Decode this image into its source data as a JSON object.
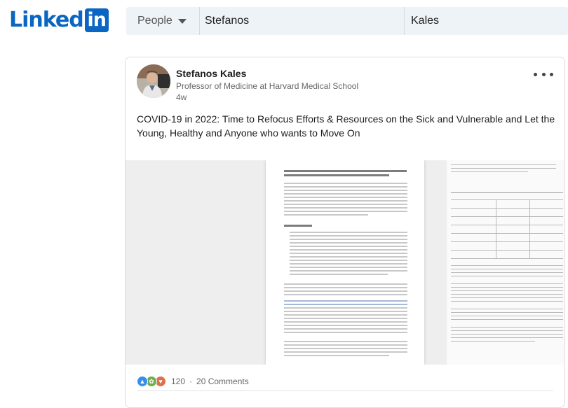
{
  "logo": {
    "text": "Linked",
    "box": "in",
    "color": "#0a66c2"
  },
  "search": {
    "type_label": "People",
    "first_name_value": "Stefanos",
    "last_name_value": "Kales"
  },
  "post": {
    "author": "Stefanos Kales",
    "headline": "Professor of Medicine at Harvard Medical School",
    "time": "4w",
    "text": "COVID-19 in 2022: Time to Refocus Efforts & Resources on the Sick and Vulnerable and Let the Young, Healthy and Anyone who wants to Move On",
    "reactions": {
      "icons": [
        "like-icon",
        "support-icon",
        "love-icon"
      ],
      "count": "120",
      "separator": "·",
      "comments": "20 Comments"
    }
  }
}
